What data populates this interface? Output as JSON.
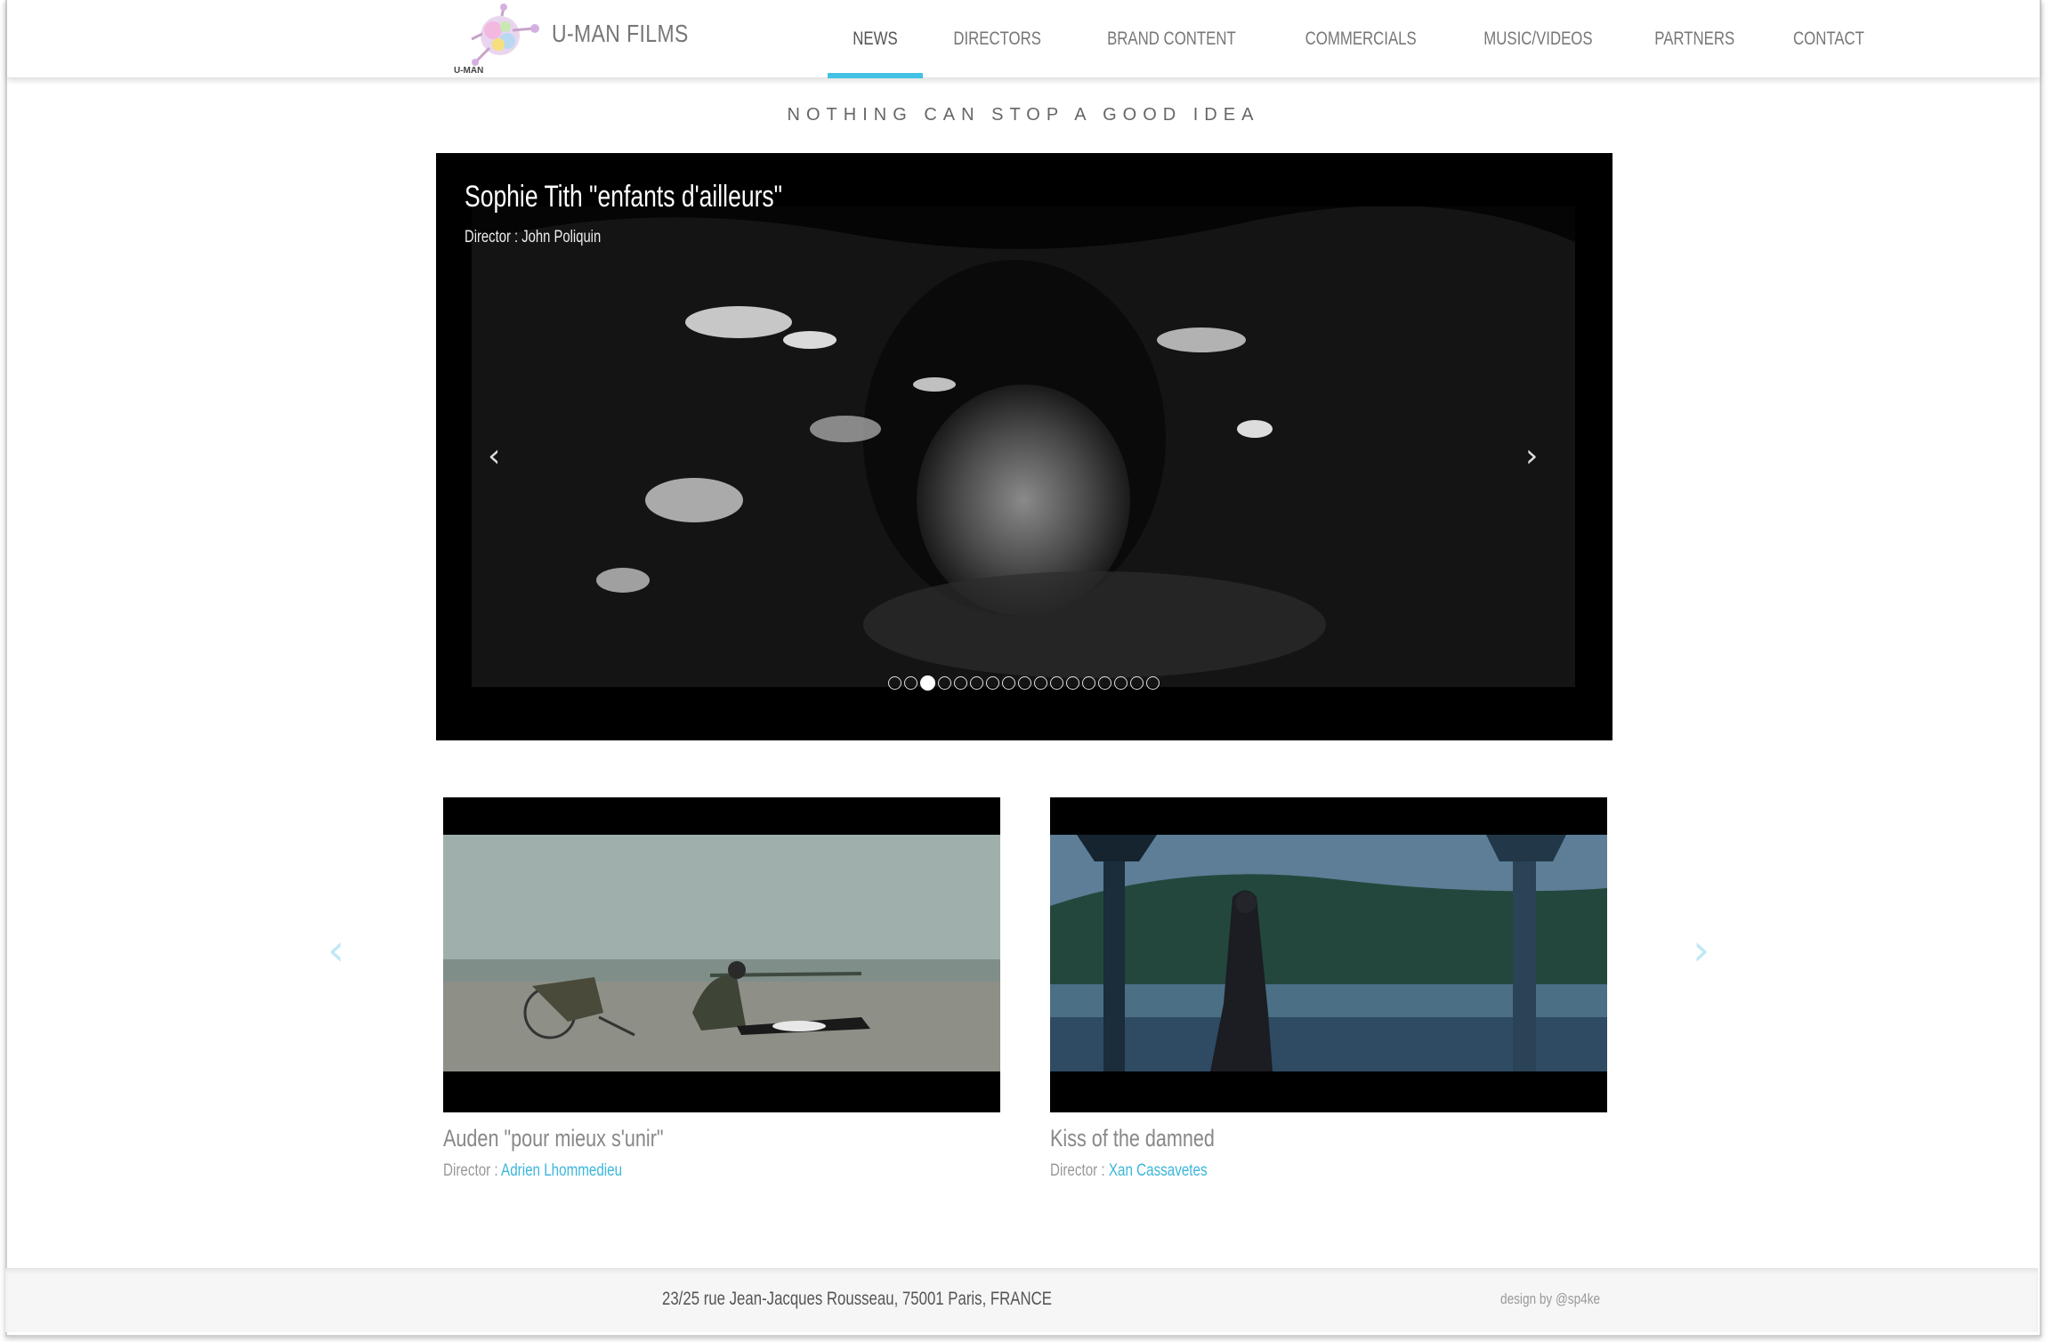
{
  "brand": {
    "name": "U-MAN FILMS",
    "logo_text": "U-MAN"
  },
  "nav": [
    {
      "label": "NEWS",
      "active": true
    },
    {
      "label": "DIRECTORS"
    },
    {
      "label": "BRAND CONTENT"
    },
    {
      "label": "COMMERCIALS"
    },
    {
      "label": "MUSIC/VIDEOS"
    },
    {
      "label": "PARTNERS"
    },
    {
      "label": "CONTACT"
    }
  ],
  "tagline": "NOTHING CAN STOP A GOOD IDEA",
  "hero": {
    "title": "Sophie Tith \"enfants d'ailleurs\"",
    "subtitle": "Director : John Poliquin",
    "prev_icon": "‹",
    "next_icon": "›",
    "slide_count": 17,
    "active_slide": 3
  },
  "cards": [
    {
      "title": "Auden \"pour mieux s'unir\"",
      "director_prefix": "Director : ",
      "director": "Adrien Lhommedieu"
    },
    {
      "title": "Kiss of the damned",
      "director_prefix": "Director : ",
      "director": "Xan Cassavetes"
    }
  ],
  "cards_nav": {
    "prev_icon": "‹",
    "next_icon": "›"
  },
  "footer": {
    "address": "23/25 rue Jean-Jacques Rousseau, 75001 Paris, FRANCE",
    "credit": "design by @sp4ke"
  },
  "colors": {
    "accent": "#43c2e6",
    "link": "#3bb6dc",
    "arrow": "#bfe8f5"
  }
}
